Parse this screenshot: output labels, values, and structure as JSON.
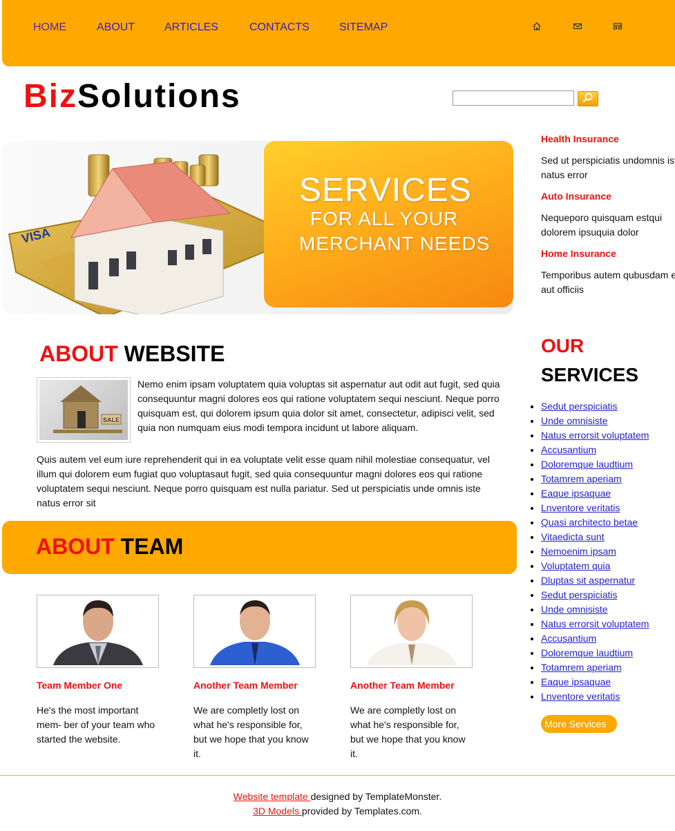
{
  "nav": {
    "items": [
      "HOME",
      "ABOUT",
      "ARTICLES",
      "CONTACTS",
      "SITEMAP"
    ],
    "icons": [
      "home-icon",
      "mail-icon",
      "sitemap-icon"
    ]
  },
  "logo": {
    "part1": "Biz",
    "part2": "Solutions"
  },
  "search": {
    "value": "",
    "button_icon": "search-icon"
  },
  "banner": {
    "line1": "SERVICES",
    "line2": "FOR ALL YOUR",
    "line3": "MERCHANT NEEDS"
  },
  "about_website": {
    "title_red": "ABOUT",
    "title_black": "WEBSITE",
    "lines1": [
      "Nemo enim ipsam voluptatem quia voluptas sit aspernatur aut odit aut fugit, sed quia",
      "consequuntur magni dolores eos qui ratione voluptatem sequi nesciunt. Neque porro",
      "quisquam est, qui dolorem ipsum quia dolor sit amet, consectetur, adipisci velit, sed",
      "quia non numquam eius modi tempora incidunt ut labore aliquam."
    ],
    "lines2": [
      "Quis autem vel eum iure reprehenderit qui in ea voluptate velit esse quam nihil molestiae consequatur, vel",
      "illum qui dolorem eum fugiat quo voluptasaut fugit, sed quia consequuntur magni dolores eos qui ratione",
      "voluptatem sequi nesciunt. Neque porro quisquam est nulla pariatur. Sed ut perspiciatis unde omnis iste",
      "natus error sit"
    ]
  },
  "about_team": {
    "title_red": "ABOUT",
    "title_black": "TEAM",
    "members": [
      {
        "name": "Team Member One",
        "lines": [
          "He's the most important",
          "mem- ber of your team who",
          "started the website."
        ]
      },
      {
        "name": "Another Team Member",
        "lines": [
          "We are completly lost on",
          "what he's responsible for,",
          "but we hope that you know",
          "it."
        ]
      },
      {
        "name": "Another Team Member",
        "lines": [
          "We are completly lost on",
          "what he's responsible for,",
          "but we hope that you know",
          "it."
        ]
      }
    ]
  },
  "sidebar": {
    "insurance": [
      {
        "title": "Health Insurance",
        "lines": [
          "Sed ut perspiciatis undomnis iste",
          "natus error"
        ]
      },
      {
        "title": "Auto Insurance",
        "lines": [
          "Nequeporo quisquam estqui",
          "dolorem ipsuquia dolor"
        ]
      },
      {
        "title": "Home Insurance",
        "lines": [
          "Temporibus autem qubusdam et",
          "aut officiis"
        ]
      }
    ],
    "services_title_red": "OUR",
    "services_title_black": "SERVICES",
    "services": [
      "Sedut perspiciatis",
      "Unde omnisiste",
      "Natus errorsit voluptatem",
      "Accusantium",
      "Doloremque laudtium",
      "Totamrem aperiam",
      "Eaque ipsaquae",
      "Lnventore veritatis",
      "Quasi architecto betae",
      "Vitaedicta sunt",
      "Nemoenim ipsam",
      "Voluptatem quia",
      "Dluptas sit aspernatur",
      "Sedut perspiciatis",
      "Unde omnisiste",
      "Natus errorsit voluptatem",
      "Accusantium",
      "Doloremque laudtium",
      "Totamrem aperiam",
      "Eaque ipsaquae",
      "Lnventore veritatis"
    ],
    "more_button": "More Services"
  },
  "footer": {
    "line1_link": "Website template ",
    "line1_text": "designed by TemplateMonster.",
    "line2_link": "3D Models ",
    "line2_text": "provided by Templates.com."
  },
  "colors": {
    "accent": "#ffa800",
    "red": "#ee1111",
    "link": "#2222cc"
  }
}
